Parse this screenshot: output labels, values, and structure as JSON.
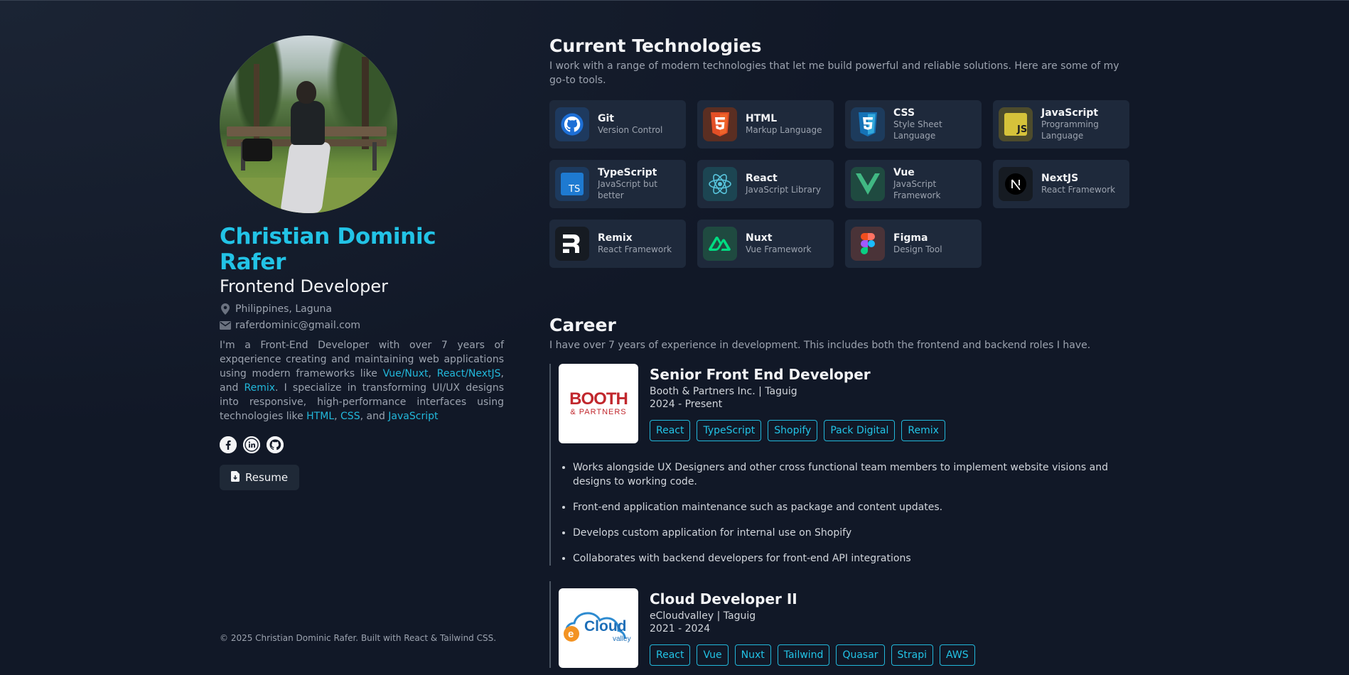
{
  "profile": {
    "name": "Christian Dominic Rafer",
    "role": "Frontend Developer",
    "location": "Philippines, Laguna",
    "email": "raferdominic@gmail.com",
    "bio": {
      "p1": "I'm a Front-End Developer with over 7 years of expqerience creating and maintaining web applications using modern frameworks like ",
      "hl1": "Vue/Nuxt",
      "p2": ", ",
      "hl2": "React/NextJS",
      "p3": ", and ",
      "hl3": "Remix",
      "p4": ". I specialize in transforming UI/UX designs into responsive, high-performance interfaces using technologies like ",
      "hl4": "HTML",
      "p5": ", ",
      "hl5": "CSS",
      "p6": ", and ",
      "hl6": "JavaScript"
    },
    "resume_label": "Resume",
    "footer": "© 2025 Christian Dominic Rafer. Built with React & Tailwind CSS."
  },
  "technologies": {
    "title": "Current Technologies",
    "subtitle": "I work with a range of modern technologies that let me build powerful and reliable solutions. Here are some of my go-to tools.",
    "items": [
      {
        "name": "Git",
        "desc": "Version Control",
        "icon": "github-icon"
      },
      {
        "name": "HTML",
        "desc": "Markup Language",
        "icon": "html5-icon"
      },
      {
        "name": "CSS",
        "desc": "Style Sheet Language",
        "icon": "css3-icon"
      },
      {
        "name": "JavaScript",
        "desc": "Programming Language",
        "icon": "javascript-icon"
      },
      {
        "name": "TypeScript",
        "desc": "JavaScript but better",
        "icon": "typescript-icon"
      },
      {
        "name": "React",
        "desc": "JavaScript Library",
        "icon": "react-icon"
      },
      {
        "name": "Vue",
        "desc": "JavaScript Framework",
        "icon": "vue-icon"
      },
      {
        "name": "NextJS",
        "desc": "React Framework",
        "icon": "nextjs-icon"
      },
      {
        "name": "Remix",
        "desc": "React Framework",
        "icon": "remix-icon"
      },
      {
        "name": "Nuxt",
        "desc": "Vue Framework",
        "icon": "nuxt-icon"
      },
      {
        "name": "Figma",
        "desc": "Design Tool",
        "icon": "figma-icon"
      }
    ]
  },
  "career": {
    "title": "Career",
    "subtitle": "I have over 7 years of experience in development. This includes both the frontend and backend roles I have.",
    "jobs": [
      {
        "title": "Senior Front End Developer",
        "company": "Booth & Partners Inc. | Taguig",
        "dates": "2024 - Present",
        "logo_text": "BOOTH",
        "logo_sub": "& PARTNERS",
        "tags": [
          "React",
          "TypeScript",
          "Shopify",
          "Pack Digital",
          "Remix"
        ],
        "duties": [
          "Works alongside UX Designers and other cross functional team members to implement website visions and designs to working code.",
          "Front-end application maintenance such as package and content updates.",
          "Develops custom application for internal use on Shopify",
          "Collaborates with backend developers for front-end API integrations"
        ]
      },
      {
        "title": "Cloud Developer II",
        "company": "eCloudvalley | Taguig",
        "dates": "2021 - 2024",
        "logo_text": "Cloud",
        "logo_sub": "valley",
        "tags": [
          "React",
          "Vue",
          "Nuxt",
          "Tailwind",
          "Quasar",
          "Strapi",
          "AWS"
        ]
      }
    ]
  },
  "colors": {
    "background": "#111827",
    "accent": "#22c3e6",
    "card": "#1e293b"
  }
}
